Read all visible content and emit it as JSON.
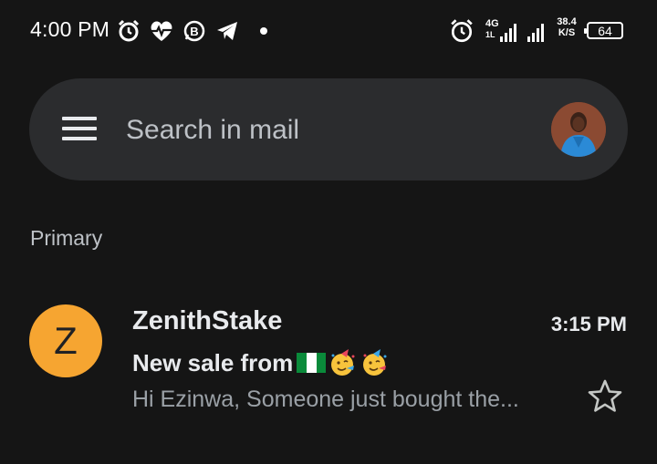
{
  "status_bar": {
    "time": "4:00 PM",
    "network_type": "4G",
    "network_sub": "1L",
    "speed_value": "38.4",
    "speed_unit": "K/S",
    "battery": "64",
    "icons": [
      "alarm-icon",
      "heart-pulse-icon",
      "b-badge-icon",
      "telegram-icon",
      "notification-dot",
      "alarm-icon",
      "signal-icon",
      "signal-icon"
    ]
  },
  "search": {
    "placeholder": "Search in mail",
    "value": ""
  },
  "section": {
    "label": "Primary"
  },
  "emails": [
    {
      "avatar_letter": "Z",
      "avatar_color": "#f6a531",
      "sender": "ZenithStake",
      "time": "3:15 PM",
      "subject": "New sale from",
      "subject_emojis": [
        "nigeria-flag",
        "partying-face",
        "partying-face"
      ],
      "snippet": "Hi Ezinwa, Someone just bought the...",
      "starred": false
    }
  ],
  "colors": {
    "background": "#151515",
    "search_bar": "#2b2c2e",
    "primary_text": "#e8eaed",
    "secondary_text": "#9aa0a6"
  }
}
